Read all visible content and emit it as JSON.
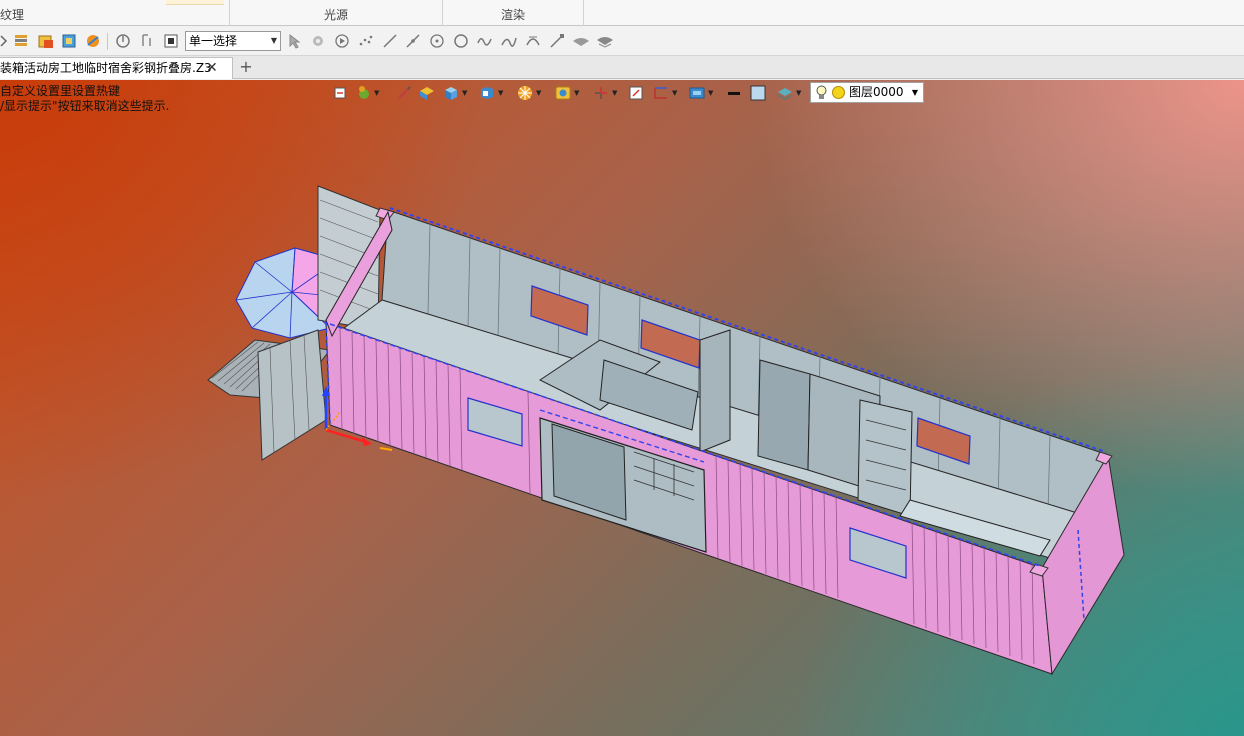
{
  "ribbon": {
    "group_texture": "纹理",
    "group_light": "光源",
    "group_render": "渲染"
  },
  "toolbar": {
    "select_mode": "单一选择",
    "icons": [
      "layers-list-icon",
      "material-icon",
      "library-icon",
      "render-icon",
      "rotate-icon",
      "pick-icon",
      "stop-icon",
      "pointer-icon",
      "select-filter-icon",
      "play-icon",
      "point-cloud-icon",
      "line-icon",
      "pen-line-icon",
      "circle-point-icon",
      "circle-icon",
      "wave-icon",
      "spline-icon",
      "arc-icon",
      "extend-icon",
      "surface-icon",
      "offset-surface-icon"
    ]
  },
  "tabs": {
    "document_title": "装箱活动房工地临时宿舍彩钢折叠房.Z3",
    "close_glyph": "✕",
    "add_glyph": "+"
  },
  "viewport": {
    "hint_line1": "自定义设置里设置热键",
    "hint_line2": "/显示提示\"按钮来取消这些提示.",
    "layer_name": "图层0000"
  },
  "colors": {
    "container_pink": "#e79ad8",
    "interior_gray": "#b9c8cf",
    "wire_blue": "#3344ee",
    "bg_orange": "#c8461a",
    "bg_teal": "#2f9a90"
  }
}
